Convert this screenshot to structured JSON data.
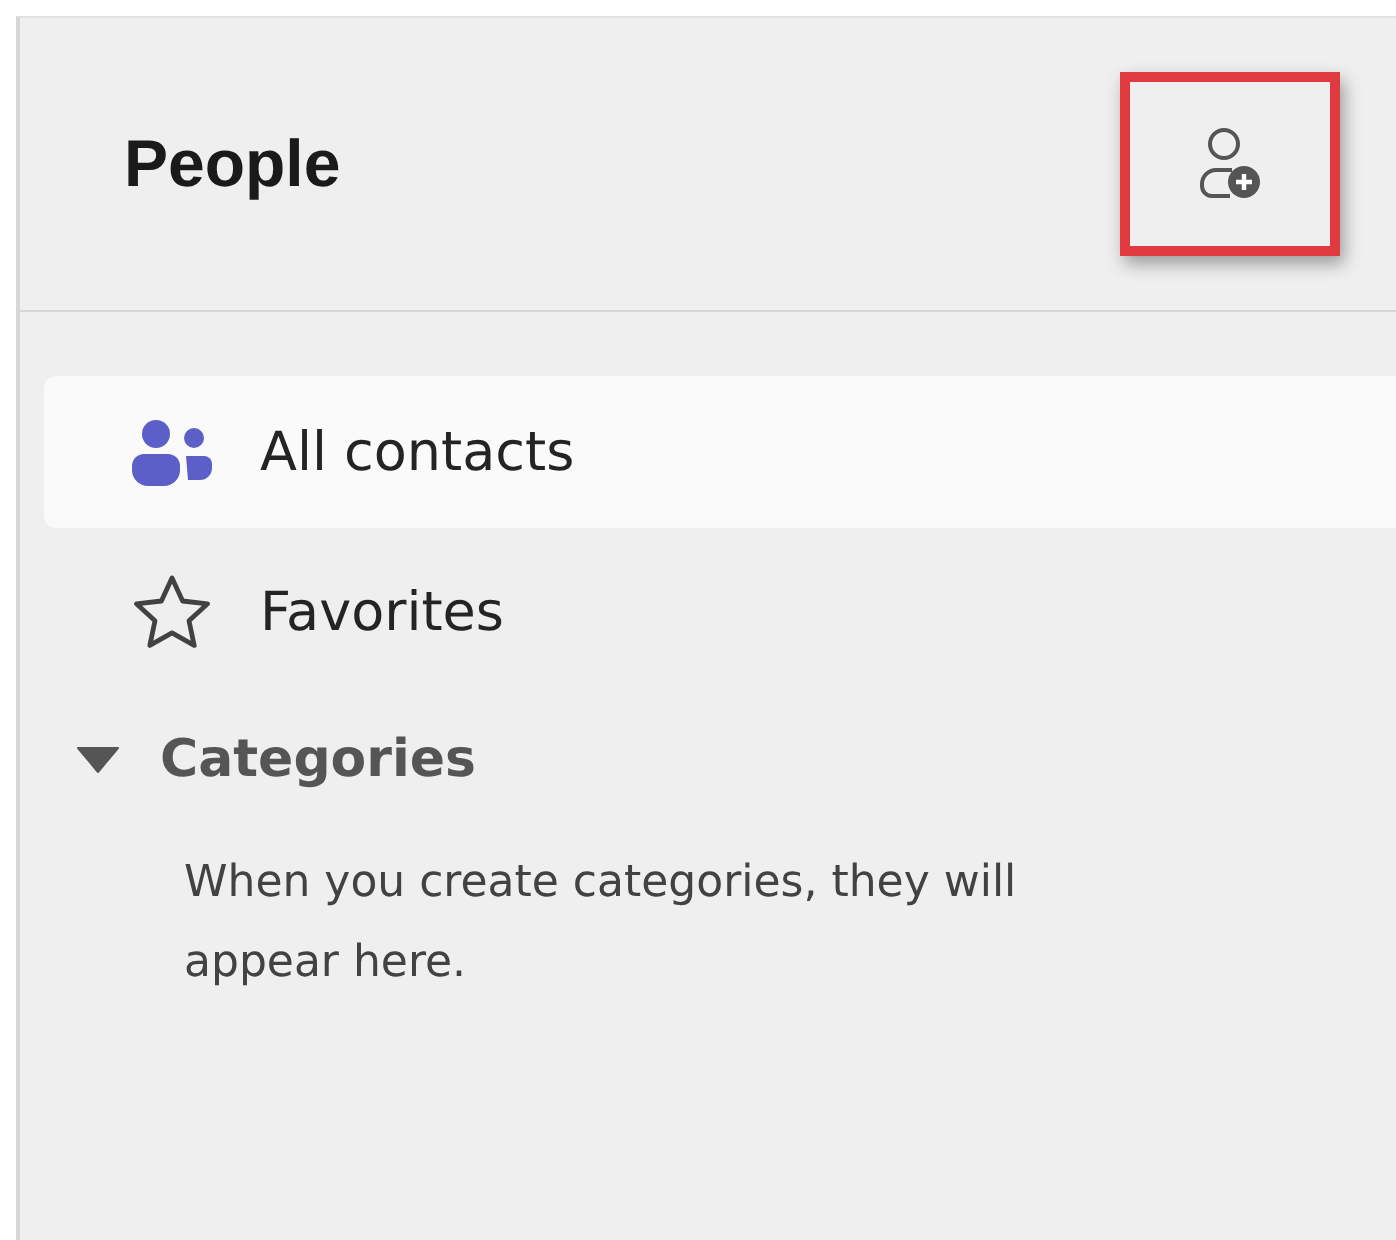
{
  "header": {
    "title": "People",
    "add_button": {
      "highlighted": true
    }
  },
  "nav_items": [
    {
      "label": "All contacts",
      "selected": true
    },
    {
      "label": "Favorites",
      "selected": false
    }
  ],
  "categories": {
    "label": "Categories",
    "expanded": true,
    "empty_message": "When you create categories, they will appear here."
  }
}
